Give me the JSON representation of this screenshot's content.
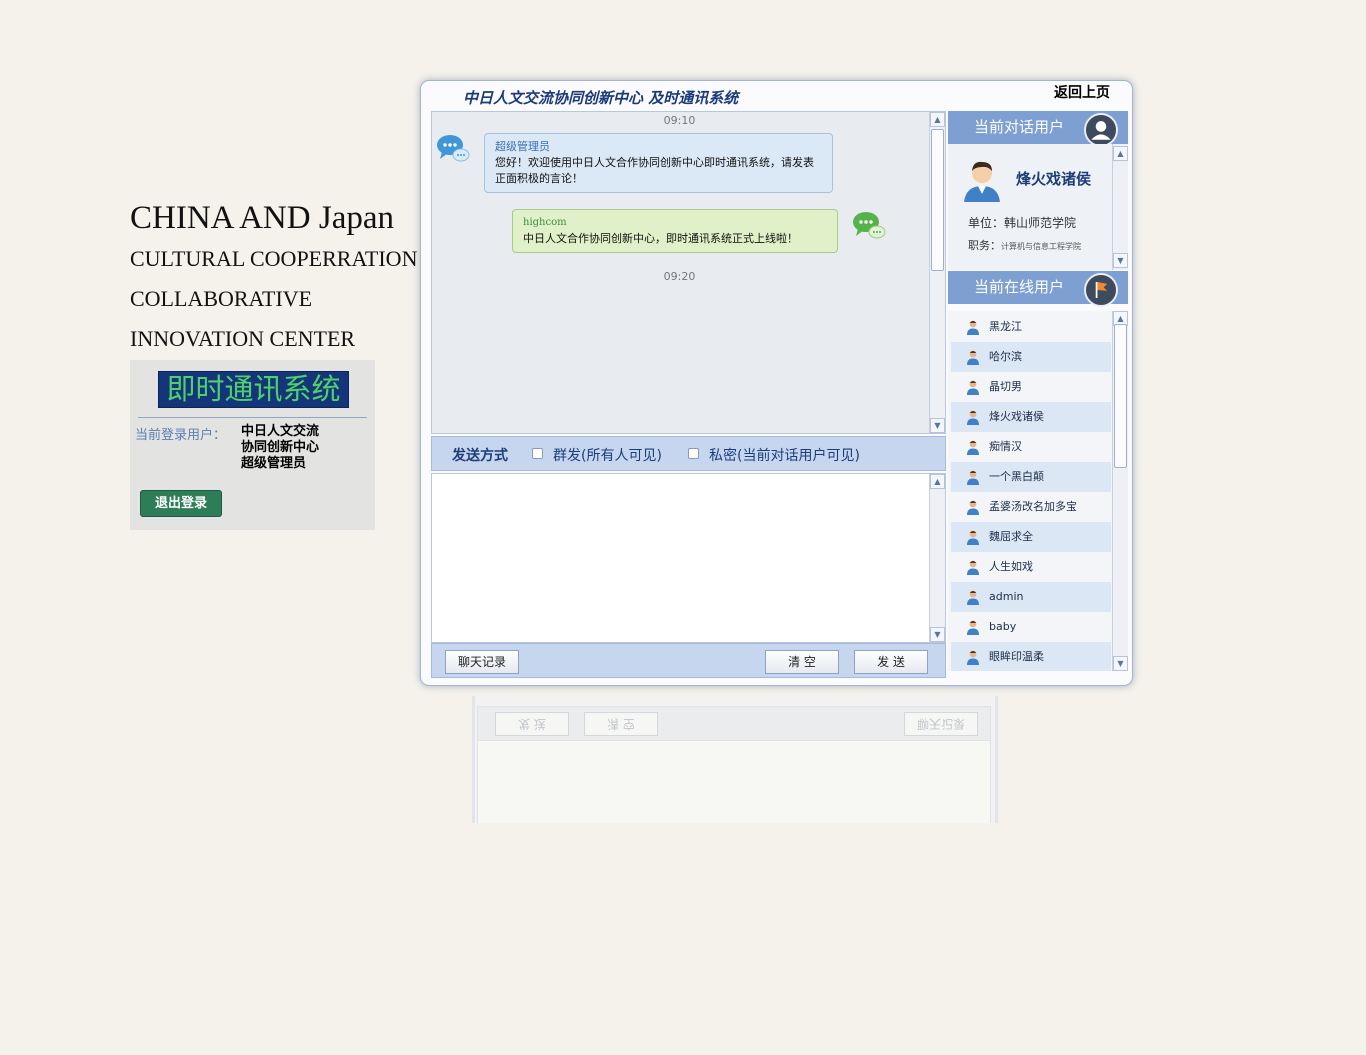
{
  "brand": {
    "line1": "CHINA AND Japan",
    "line2": "CULTURAL COOPERRATION",
    "line3": "COLLABORATIVE",
    "line4": "INNOVATION CENTER"
  },
  "login": {
    "logo_text": "即时通讯系统",
    "current_user_label": "当前登录用户：",
    "current_user_line1": "中日人文交流",
    "current_user_line2": "协同创新中心",
    "current_user_line3": "超级管理员",
    "logout_label": "退出登录"
  },
  "window": {
    "title": "中日人文交流协同创新中心  及时通讯系统",
    "back_label": "返回上页"
  },
  "chat": {
    "messages": [
      {
        "time": "09:10",
        "sender": "超级管理员",
        "text": "您好！欢迎使用中日人文合作协同创新中心即时通讯系统，请发表正面积极的言论！"
      },
      {
        "sender": "highcom",
        "text": "中日人文合作协同创新中心，即时通讯系统正式上线啦！"
      }
    ],
    "time2": "09:20"
  },
  "send_mode": {
    "label": "发送方式",
    "option_group": "群发(所有人可见)",
    "option_private": "私密(当前对话用户可见)"
  },
  "buttons": {
    "history": "聊天记录",
    "clear": "清 空",
    "send": "发 送"
  },
  "current_chat": {
    "header": "当前对话用户",
    "name": "烽火戏诸侯",
    "unit_label": "单位：",
    "unit": "韩山师范学院",
    "job_label": "职务：",
    "job": "计算机与信息工程学院"
  },
  "online": {
    "header": "当前在线用户",
    "users": [
      "黑龙江",
      "哈尔滨",
      "晶切男",
      "烽火戏诸侯",
      "痴情汉",
      "一个黑白颠",
      "孟婆汤改名加多宝",
      "魏屈求全",
      "人生如戏",
      "admin",
      "baby",
      "眼眸印温柔"
    ]
  },
  "ghost": {
    "send": "发 送",
    "clear": "清 空",
    "history": "聊天记录"
  },
  "colors": {
    "accent": "#7d9fd1",
    "title_blue": "#1b3a7a",
    "logout_green": "#2d7d58"
  }
}
